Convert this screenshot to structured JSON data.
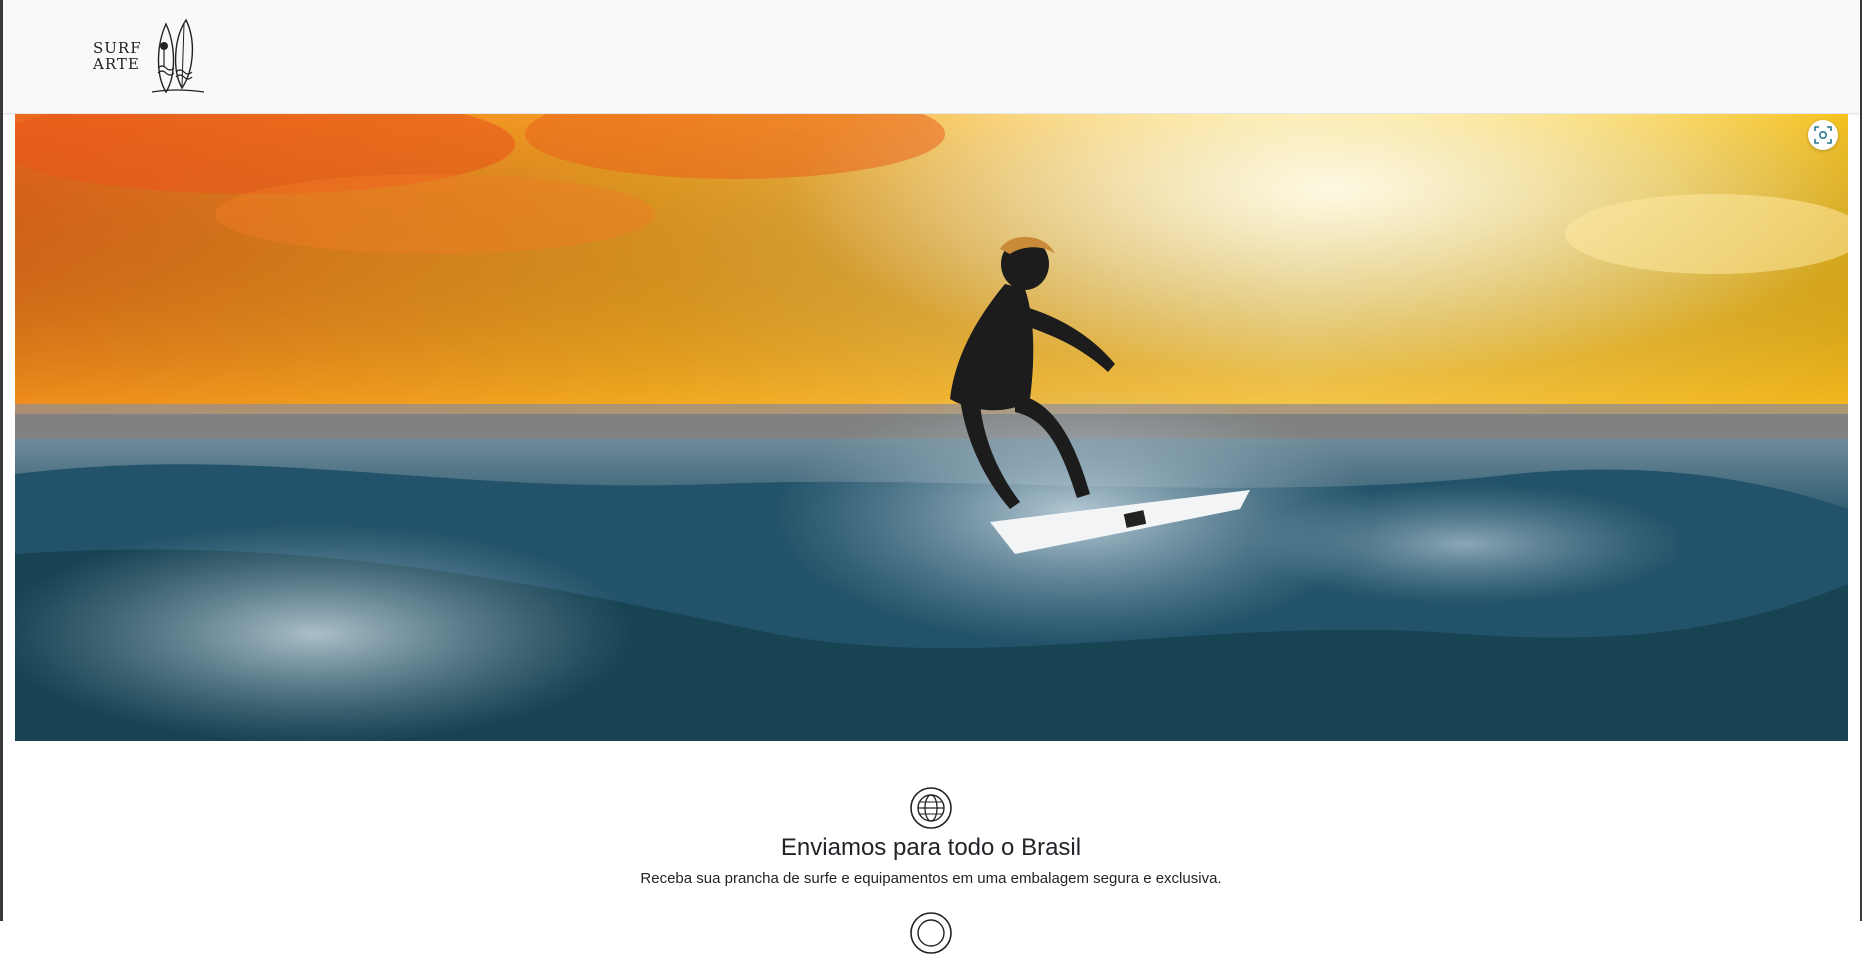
{
  "brand": {
    "line1": "SURF",
    "line2": "ARTE",
    "logo_icon": "surfboards-icon"
  },
  "hero": {
    "image": "surfer-sunset-wave-photo",
    "lens_icon": "visual-search-icon",
    "colors": {
      "sky_orange": "#f07a1e",
      "sky_yellow": "#f9d22a",
      "sea_dark": "#1c4a5c"
    }
  },
  "features": [
    {
      "icon": "globe-icon",
      "title": "Enviamos para todo o Brasil",
      "text": "Receba sua prancha de surfe e equipamentos em uma embalagem segura e exclusiva."
    }
  ]
}
